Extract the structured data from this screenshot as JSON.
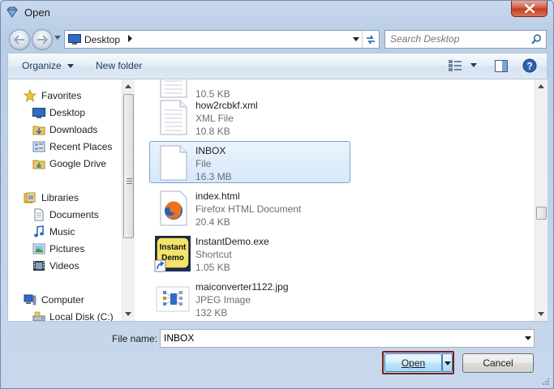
{
  "window": {
    "title": "Open",
    "app_icon": "gem-icon"
  },
  "address": {
    "location": "Desktop"
  },
  "search": {
    "placeholder": "Search Desktop"
  },
  "toolbar": {
    "organize": "Organize",
    "new_folder": "New folder"
  },
  "navigation": {
    "groups": [
      {
        "label": "Favorites",
        "icon": "star-icon",
        "items": [
          {
            "label": "Desktop",
            "icon": "desktop-icon"
          },
          {
            "label": "Downloads",
            "icon": "downloads-icon"
          },
          {
            "label": "Recent Places",
            "icon": "recent-places-icon"
          },
          {
            "label": "Google Drive",
            "icon": "google-drive-icon"
          }
        ]
      },
      {
        "label": "Libraries",
        "icon": "libraries-icon",
        "items": [
          {
            "label": "Documents",
            "icon": "documents-icon"
          },
          {
            "label": "Music",
            "icon": "music-icon"
          },
          {
            "label": "Pictures",
            "icon": "pictures-icon"
          },
          {
            "label": "Videos",
            "icon": "videos-icon"
          }
        ]
      },
      {
        "label": "Computer",
        "icon": "computer-icon",
        "items": [
          {
            "label": "Local Disk (C:)",
            "icon": "disk-icon"
          }
        ]
      }
    ]
  },
  "files": [
    {
      "name": "",
      "type": "",
      "size": "10.5 KB",
      "icon": "document-icon"
    },
    {
      "name": "how2rcbkf.xml",
      "type": "XML File",
      "size": "10.8 KB",
      "icon": "document-icon"
    },
    {
      "name": "INBOX",
      "type": "File",
      "size": "16.3 MB",
      "icon": "blank-file-icon",
      "selected": true
    },
    {
      "name": "index.html",
      "type": "Firefox HTML Document",
      "size": "20.4 KB",
      "icon": "firefox-icon"
    },
    {
      "name": "InstantDemo.exe",
      "type": "Shortcut",
      "size": "1.05 KB",
      "icon": "instantdemo-icon"
    },
    {
      "name": "maiconverter1122.jpg",
      "type": "JPEG Image",
      "size": "132 KB",
      "icon": "jpeg-icon"
    }
  ],
  "filename": {
    "label": "File name:",
    "value": "INBOX"
  },
  "buttons": {
    "open": "Open",
    "cancel": "Cancel"
  },
  "colors": {
    "selection": "#d6e8fb",
    "selection_border": "#7da2ce",
    "focus_outline": "#7a1f1f"
  }
}
